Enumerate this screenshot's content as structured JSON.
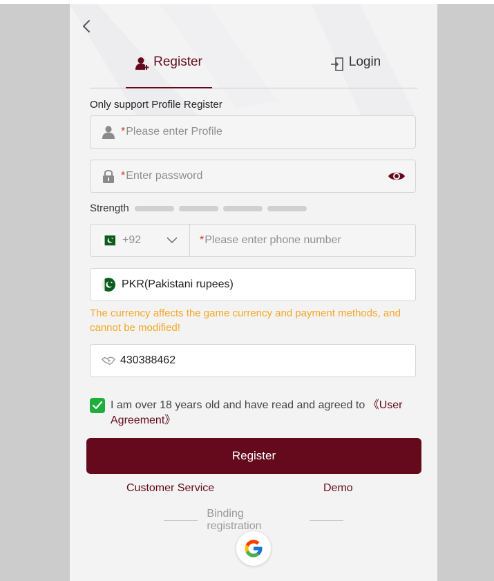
{
  "tabs": {
    "register": "Register",
    "login": "Login"
  },
  "form": {
    "hint": "Only support Profile Register",
    "required_mark": "*",
    "profile_placeholder": "Please enter Profile",
    "password_placeholder": "Enter password",
    "strength_label": "Strength",
    "phone_code": "+92",
    "phone_placeholder": "Please enter phone number",
    "currency_value": "PKR(Pakistani rupees)",
    "currency_warning": "The currency affects the game currency and payment methods, and cannot be modified!",
    "invite_code": "430388462",
    "agreement_text": "I am over 18 years old and have read and agreed to ",
    "agreement_link": "《User Agreement》",
    "agreement_checked": true
  },
  "actions": {
    "register_button": "Register",
    "customer_service": "Customer Service",
    "demo": "Demo",
    "binding_title": "Binding registration"
  },
  "icons": {
    "back": "back-arrow-icon",
    "register_tab": "user-add-icon",
    "login_tab": "login-door-icon",
    "profile": "user-icon",
    "password": "lock-icon",
    "visibility": "eye-icon",
    "flag": "pakistan-flag-icon",
    "dropdown": "chevron-down-icon",
    "invite": "handshake-icon",
    "google": "google-icon"
  },
  "colors": {
    "brand": "#640a1c",
    "warning": "#f5a623",
    "check": "#1fae3b",
    "background": "#cccccc",
    "panel": "#f3f3f3"
  }
}
